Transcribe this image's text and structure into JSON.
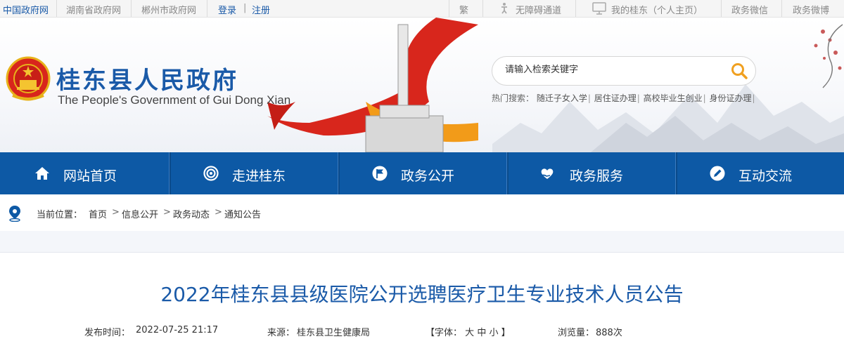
{
  "topbar": {
    "links": [
      "中国政府网",
      "湖南省政府网",
      "郴州市政府网"
    ],
    "login": "登录",
    "divider": "|",
    "register": "注册",
    "traditional": "繁",
    "accessibility": "无障碍通道",
    "my_page": "我的桂东（个人主页）",
    "wechat": "政务微信",
    "weibo": "政务微博"
  },
  "header": {
    "title": "桂东县人民政府",
    "subtitle": "The People's Government of Gui Dong Xian"
  },
  "search": {
    "placeholder": "请输入检索关键字",
    "hot_label": "热门搜索：",
    "hot_keywords": [
      "随迁子女入学",
      "居住证办理",
      "高校毕业生创业",
      "身份证办理"
    ],
    "separator": "|"
  },
  "nav": {
    "items": [
      {
        "label": "网站首页",
        "icon": "home-icon"
      },
      {
        "label": "走进桂东",
        "icon": "target-icon"
      },
      {
        "label": "政务公开",
        "icon": "flag-icon"
      },
      {
        "label": "政务服务",
        "icon": "heart-hand-icon"
      },
      {
        "label": "互动交流",
        "icon": "pen-icon"
      }
    ]
  },
  "breadcrumb": {
    "label": "当前位置：",
    "items": [
      "首页",
      "信息公开",
      "政务动态",
      "通知公告"
    ],
    "separator": ">"
  },
  "article": {
    "title": "2022年桂东县县级医院公开选聘医疗卫生专业技术人员公告",
    "publish_label": "发布时间：",
    "publish_time": "2022-07-25 21:17",
    "source_label": "来源：",
    "source": "桂东县卫生健康局",
    "font_open": "【字体：",
    "font_large": "大",
    "font_medium": "中",
    "font_small": "小",
    "font_close": "】",
    "views_label": "浏览量：",
    "views": "888次"
  },
  "colors": {
    "brand_blue": "#0d59a5",
    "title_blue": "#1a5aa8",
    "accent_red": "#d8261c"
  }
}
